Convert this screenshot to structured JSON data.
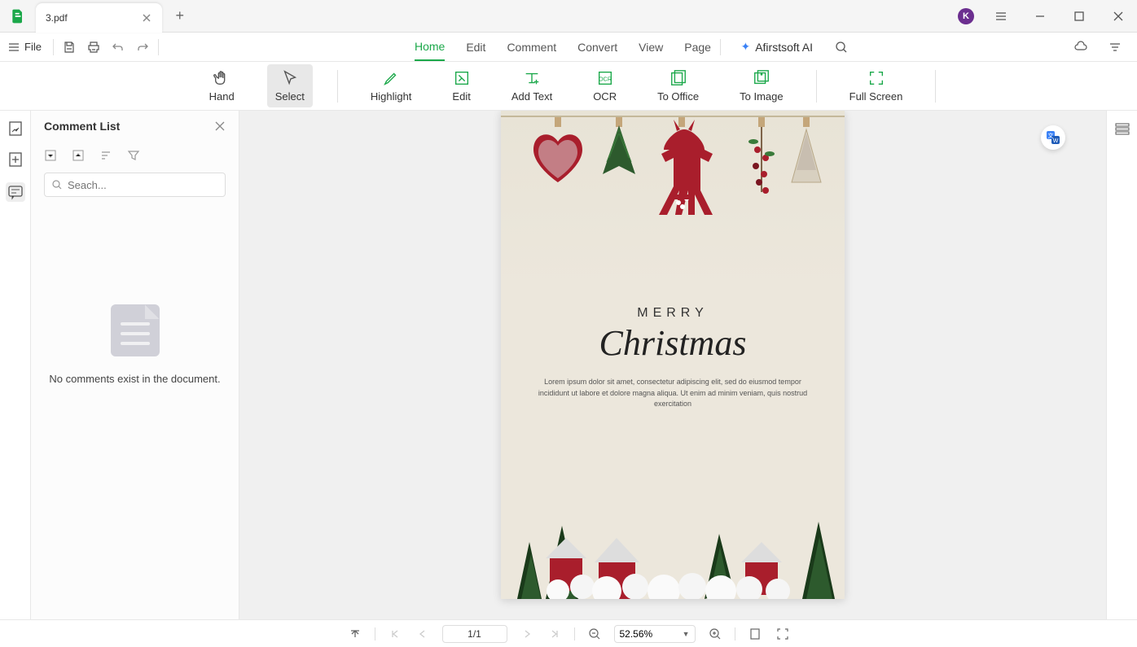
{
  "title_bar": {
    "tab_name": "3.pdf",
    "avatar_letter": "K"
  },
  "menu_bar": {
    "file_label": "File",
    "tabs": [
      "Home",
      "Edit",
      "Comment",
      "Convert",
      "View",
      "Page"
    ],
    "active_tab": 0,
    "ai_label": "Afirstsoft AI"
  },
  "toolbar": {
    "tools": [
      {
        "label": "Hand",
        "icon": "hand"
      },
      {
        "label": "Select",
        "icon": "cursor",
        "selected": true
      },
      {
        "label": "Highlight",
        "icon": "highlight"
      },
      {
        "label": "Edit",
        "icon": "edit"
      },
      {
        "label": "Add Text",
        "icon": "addtext"
      },
      {
        "label": "OCR",
        "icon": "ocr"
      },
      {
        "label": "To Office",
        "icon": "office"
      },
      {
        "label": "To Image",
        "icon": "image"
      },
      {
        "label": "Full Screen",
        "icon": "fullscreen"
      }
    ]
  },
  "comment_panel": {
    "title": "Comment List",
    "search_placeholder": "Seach...",
    "empty_text": "No comments exist in the document."
  },
  "document": {
    "line1": "MERRY",
    "line2": "Christmas",
    "body": "Lorem ipsum dolor sit amet, consectetur adipiscing elit, sed do eiusmod tempor incididunt ut labore et dolore magna aliqua. Ut enim ad minim veniam, quis nostrud exercitation"
  },
  "status_bar": {
    "page_display": "1/1",
    "zoom_display": "52.56%"
  },
  "colors": {
    "accent_green": "#1ba84a",
    "avatar_purple": "#6b2e8f",
    "page_bg": "#ece7dc",
    "christmas_red": "#a91e2c"
  }
}
